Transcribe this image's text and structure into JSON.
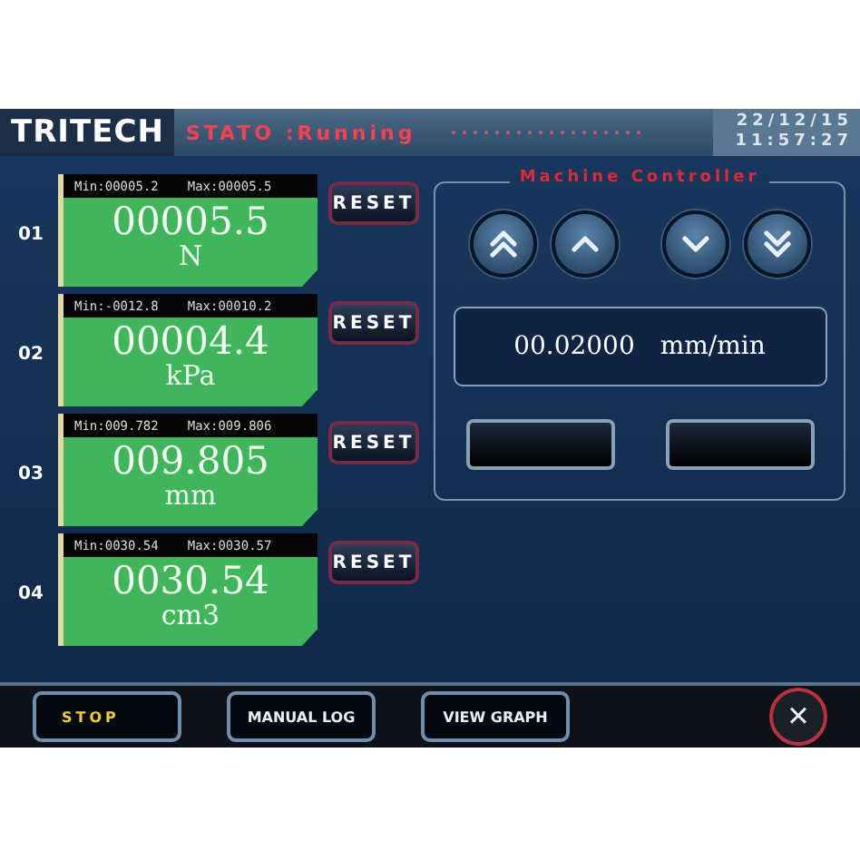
{
  "header": {
    "logo": "TRITECH",
    "status": "STATO :Running",
    "date": "22/12/15",
    "time": "11:57:27"
  },
  "channels": [
    {
      "number": "01",
      "min": "Min:00005.2",
      "max": "Max:00005.5",
      "value": "00005.5",
      "unit": "N",
      "reset": "RESET"
    },
    {
      "number": "02",
      "min": "Min:-0012.8",
      "max": "Max:00010.2",
      "value": "00004.4",
      "unit": "kPa",
      "reset": "RESET"
    },
    {
      "number": "03",
      "min": "Min:009.782",
      "max": "Max:009.806",
      "value": "009.805",
      "unit": "mm",
      "reset": "RESET"
    },
    {
      "number": "04",
      "min": "Min:0030.54",
      "max": "Max:0030.57",
      "value": "0030.54",
      "unit": "cm3",
      "reset": "RESET"
    }
  ],
  "controller": {
    "title": "Machine Controller",
    "buttons": [
      {
        "kind": "fast-up"
      },
      {
        "kind": "up"
      },
      {
        "kind": "down"
      },
      {
        "kind": "fast-down"
      }
    ],
    "speed": "00.02000",
    "speed_unit": "mm/min"
  },
  "footer": {
    "buttons": [
      {
        "label": "STOP",
        "kind": "stop"
      },
      {
        "label": "MANUAL LOG",
        "kind": "normal"
      },
      {
        "label": "VIEW GRAPH",
        "kind": "normal"
      }
    ],
    "close": "×"
  }
}
